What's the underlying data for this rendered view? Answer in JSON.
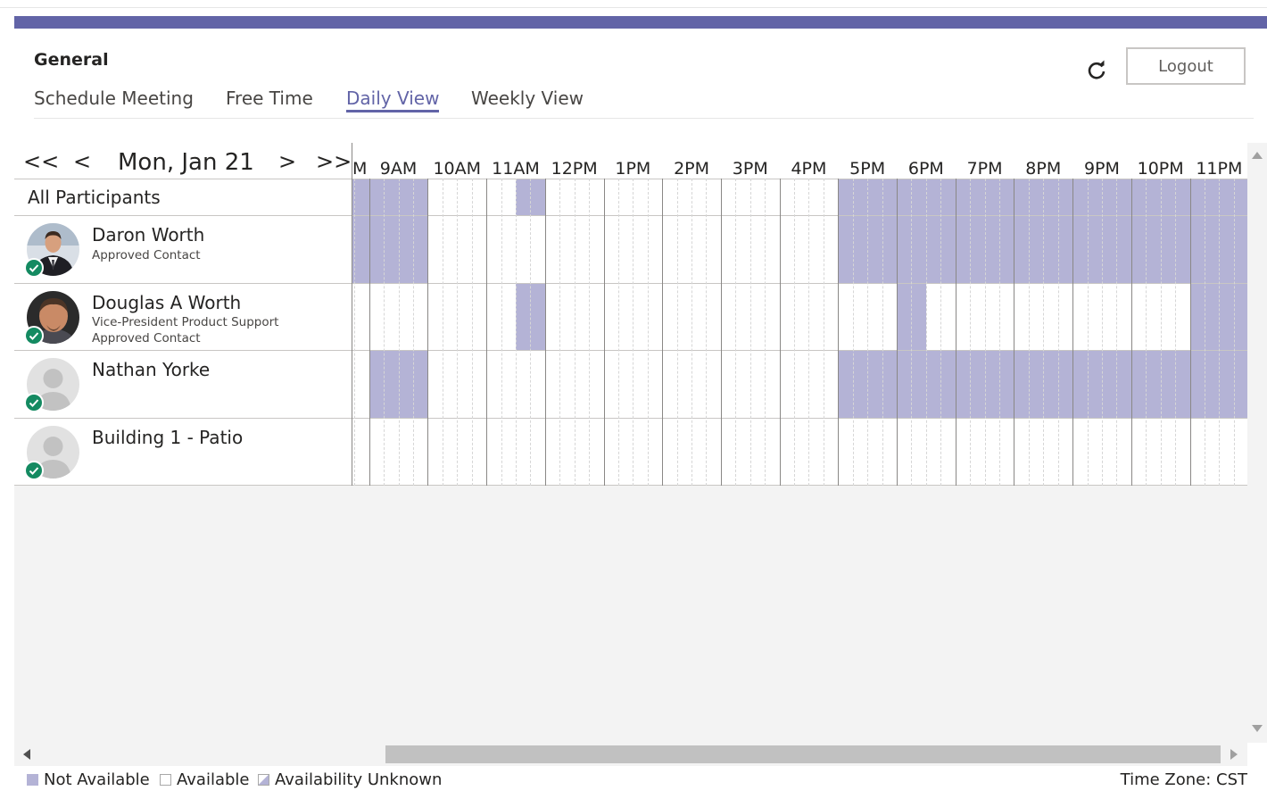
{
  "app": {
    "title": "General",
    "logout_label": "Logout",
    "accent_color": "#6264a7",
    "busy_color": "#b4b3d6"
  },
  "tabs": [
    {
      "label": "Schedule Meeting",
      "active": false
    },
    {
      "label": "Free Time",
      "active": false
    },
    {
      "label": "Daily View",
      "active": true
    },
    {
      "label": "Weekly View",
      "active": false
    }
  ],
  "date_nav": {
    "first": "<<",
    "prev": "<",
    "date": "Mon, Jan 21",
    "next": ">",
    "last": ">>"
  },
  "hours": [
    "M",
    "9AM",
    "10AM",
    "11AM",
    "12PM",
    "1PM",
    "2PM",
    "3PM",
    "4PM",
    "5PM",
    "6PM",
    "7PM",
    "8PM",
    "9PM",
    "10PM",
    "11PM"
  ],
  "participants": [
    {
      "name": "All Participants",
      "busy": [
        "08:15-10:00",
        "11:30-12:00",
        "17:00-24:00"
      ]
    },
    {
      "name": "Daron Worth",
      "lines": [
        "Approved Contact"
      ],
      "avatar": "photo-male-suit",
      "status": "approved",
      "busy": [
        "08:15-10:00",
        "17:00-24:00"
      ]
    },
    {
      "name": "Douglas A Worth",
      "lines": [
        "Vice-President Product Support",
        "Approved Contact"
      ],
      "avatar": "photo-male-goatee",
      "status": "approved",
      "busy": [
        "11:30-12:00",
        "18:00-18:30",
        "23:00-24:00"
      ]
    },
    {
      "name": "Nathan Yorke",
      "lines": [],
      "avatar": "default-person",
      "status": "approved",
      "busy": [
        "09:00-10:00",
        "17:00-24:00"
      ]
    },
    {
      "name": "Building 1 - Patio",
      "lines": [],
      "avatar": "default-person",
      "status": "approved",
      "busy": []
    }
  ],
  "legend": {
    "busy": "Not Available",
    "free": "Available",
    "unknown": "Availability Unknown",
    "timezone": "Time Zone: CST"
  },
  "icons": {
    "refresh": "refresh-icon",
    "status": "check-circle-icon"
  }
}
